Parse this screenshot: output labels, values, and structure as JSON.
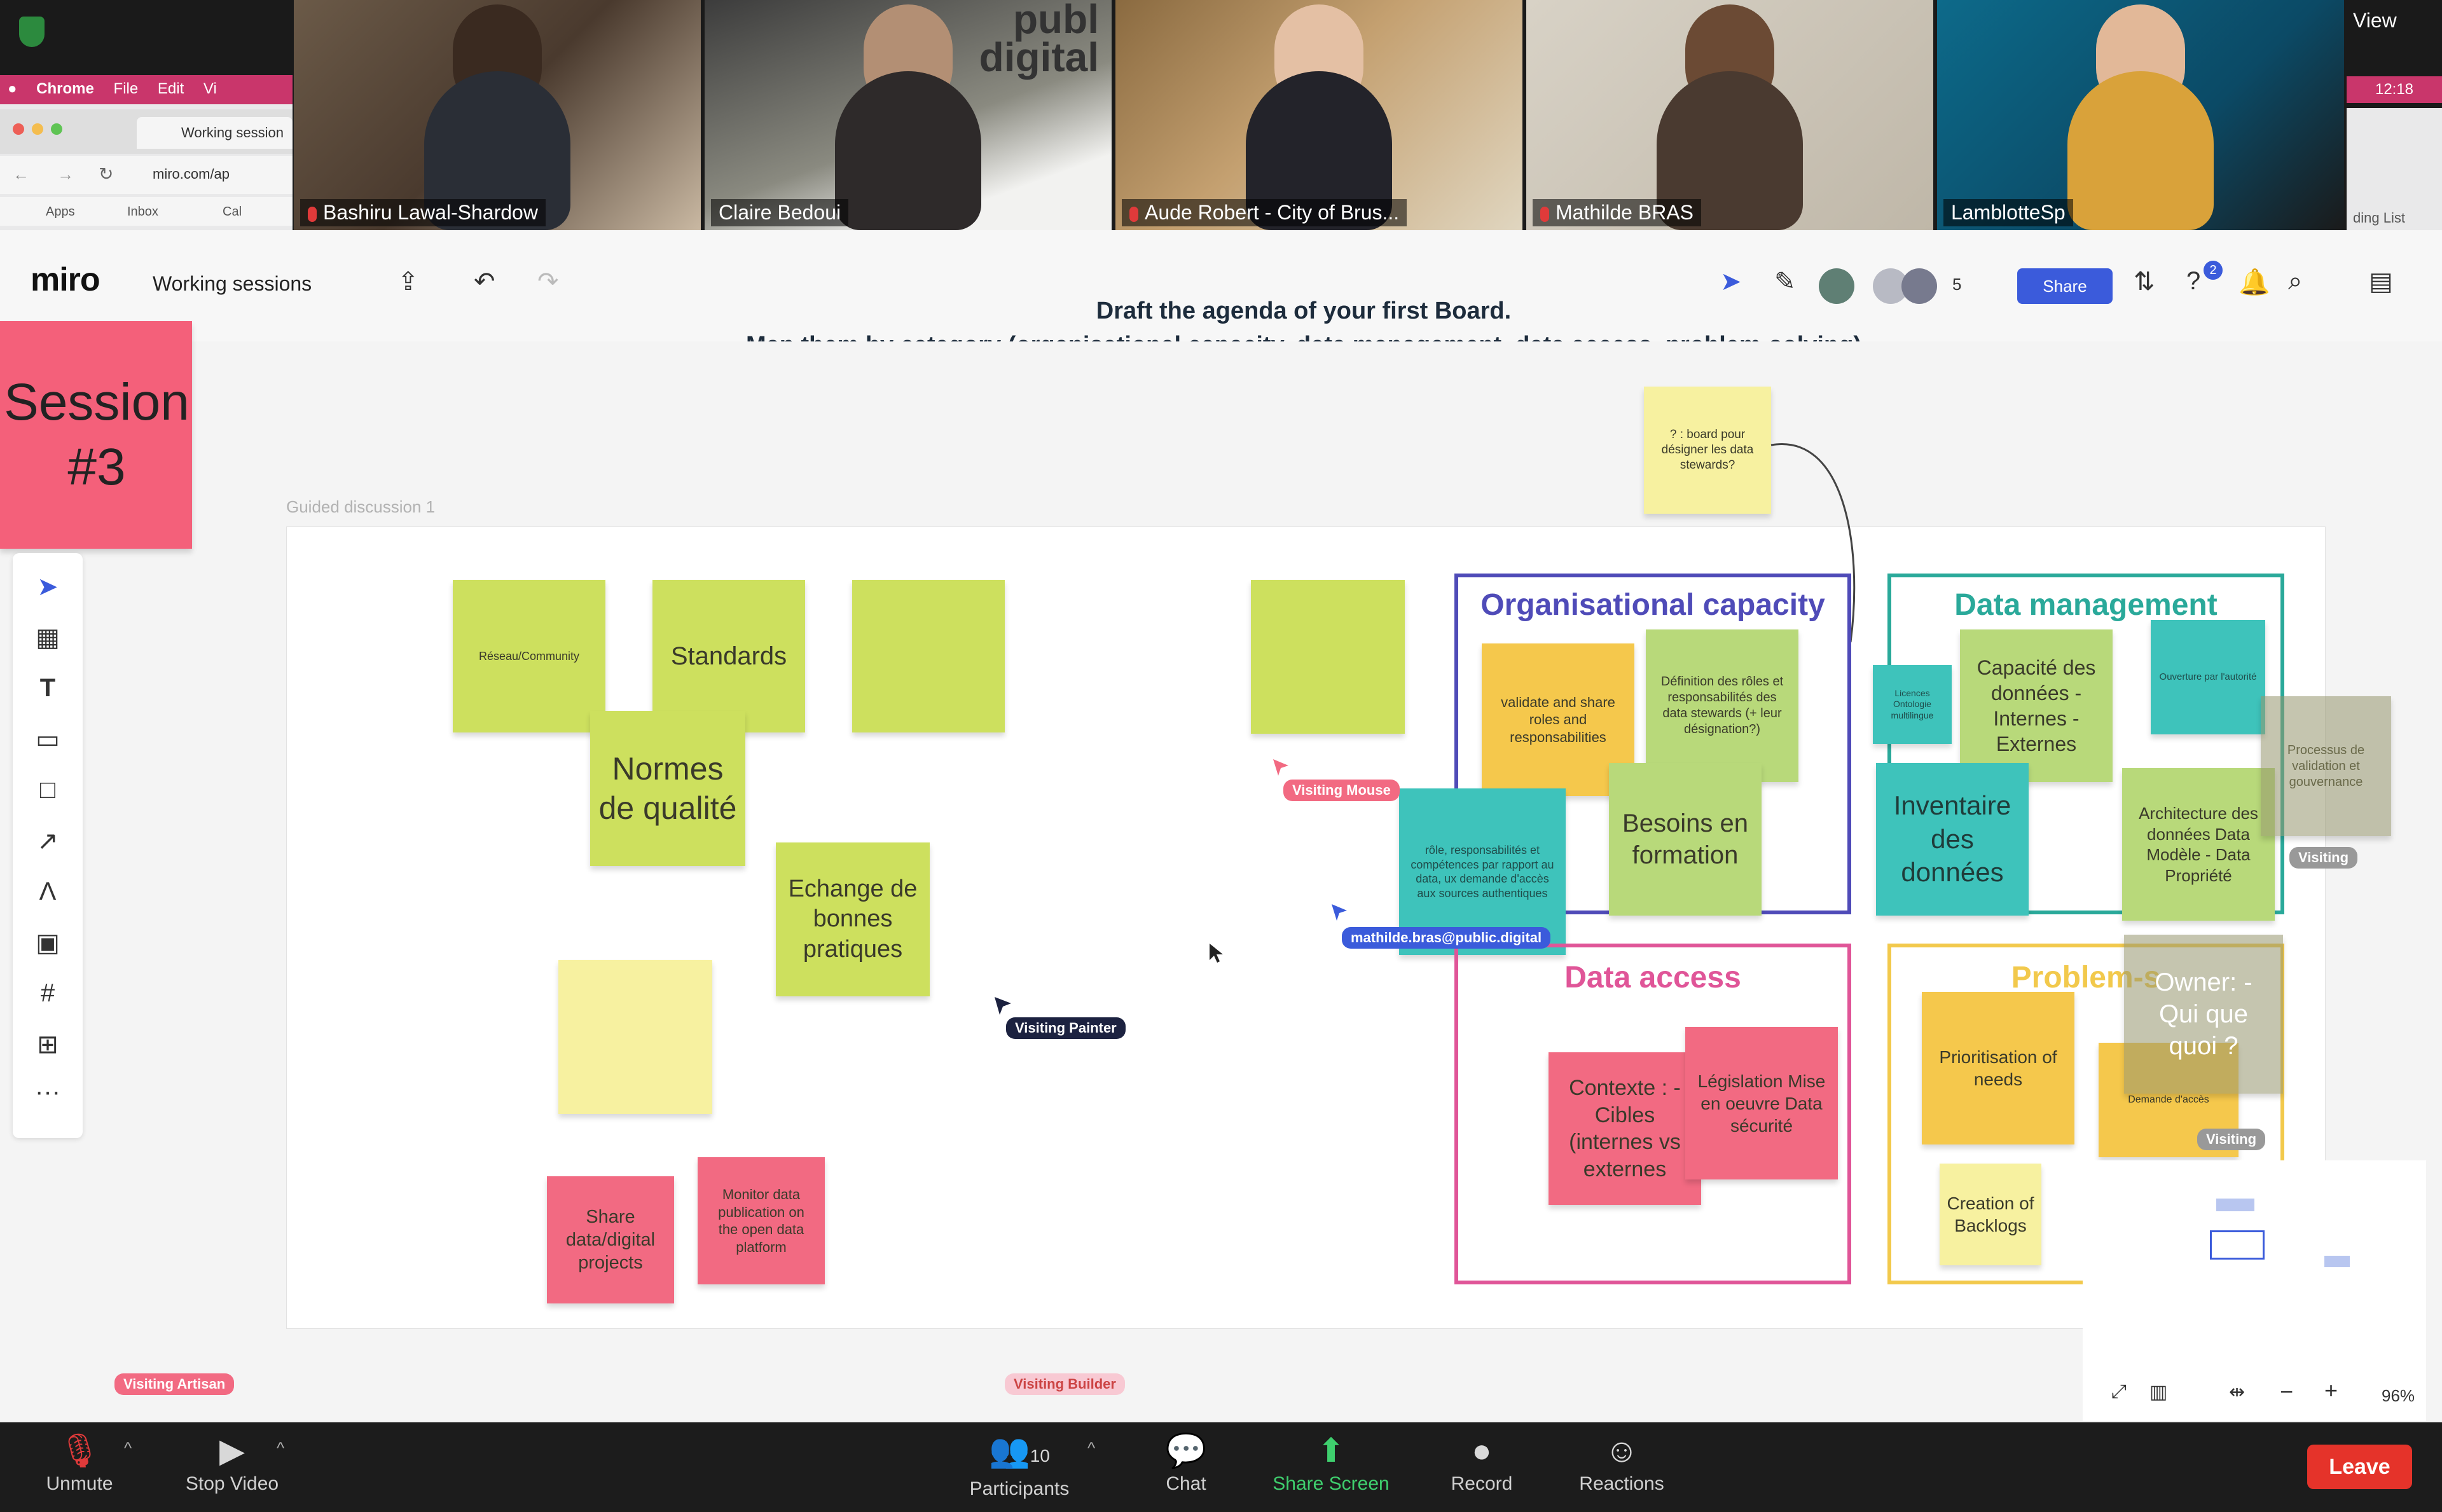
{
  "zoom": {
    "participants": [
      {
        "name": "Bashiru Lawal-Shardow",
        "muted": true
      },
      {
        "name": "Claire Bedoui",
        "muted": false
      },
      {
        "name": "Aude Robert - City of Brus...",
        "muted": true
      },
      {
        "name": "Mathilde BRAS",
        "muted": true
      },
      {
        "name": "LamblotteSp",
        "muted": false
      }
    ],
    "view_label": "View",
    "clock": "12:18",
    "controls": {
      "unmute": "Unmute",
      "stop_video": "Stop Video",
      "participants": "Participants",
      "participants_count": "10",
      "chat": "Chat",
      "share_screen": "Share Screen",
      "record": "Record",
      "reactions": "Reactions",
      "leave": "Leave"
    }
  },
  "browser": {
    "menu": [
      "Chrome",
      "File",
      "Edit",
      "Vi"
    ],
    "tab_title": "Working session",
    "url": "miro.com/ap",
    "bookmarks": [
      "Apps",
      "Inbox",
      "Cal"
    ],
    "reading_list": "ding List"
  },
  "miro": {
    "logo": "miro",
    "board_name": "Working sessions",
    "share_label": "Share",
    "collaborator_count": "5",
    "notification_count": "2",
    "zoom_level": "96%"
  },
  "board": {
    "title_line1": "Draft the agenda of your first Board.",
    "title_line2": "Map them by category (organisational capacity, data management, data access, problem-solving)",
    "session_note": "Session #3",
    "frame_label": "Guided discussion 1",
    "top_note": "? : board pour désigner les data stewards?",
    "stickies": {
      "reseau": "Réseau/Community",
      "standards": "Standards",
      "normes": "Normes de qualité",
      "echange": "Echange de bonnes pratiques",
      "share": "Share data/digital projects",
      "monitor": "Monitor data publication on the open data platform"
    },
    "categories": {
      "org": "Organisational capacity",
      "data_mgmt": "Data management",
      "data_access": "Data access",
      "problem": "Problem-s"
    },
    "org_notes": {
      "validate": "validate and share roles and responsabilities",
      "definition": "Définition des rôles et responsabilités des data stewards (+ leur désignation?)",
      "roles": "rôle, responsabilités et compétences par rapport au data, ux demande d'accès aux sources authentiques",
      "besoins": "Besoins en formation"
    },
    "dm_notes": {
      "licences": "Licences Ontologie multilingue",
      "capacite": "Capacité des données - Internes - Externes",
      "ouverture": "Ouverture par l'autorité",
      "inventaire": "Inventaire des données",
      "architecture": "Architecture des données Data Modèle - Data Propriété",
      "gov": "Processus de validation et gouvernance"
    },
    "da_notes": {
      "contexte": "Contexte : - Cibles (internes vs externes",
      "legislation": "Législation Mise en oeuvre Data sécurité"
    },
    "ps_notes": {
      "prior": "Prioritisation of needs",
      "creation": "Creation of Backlogs",
      "owner": "Owner: - Qui que quoi ?",
      "dem": "Demande d'accès"
    },
    "cursors": [
      {
        "label": "Visiting Mouse",
        "color": "#f26a82"
      },
      {
        "label": "mathilde.bras@public.digital",
        "color": "#3b5bdb"
      },
      {
        "label": "Visiting Painter",
        "color": "#1c2240"
      },
      {
        "label": "Visiting Artisan",
        "color": "#f26a82"
      },
      {
        "label": "Visiting Builder",
        "color": "#f26a82"
      },
      {
        "label": "Visiting",
        "color": "#888888"
      },
      {
        "label": "Visiting",
        "color": "#888888"
      }
    ]
  }
}
